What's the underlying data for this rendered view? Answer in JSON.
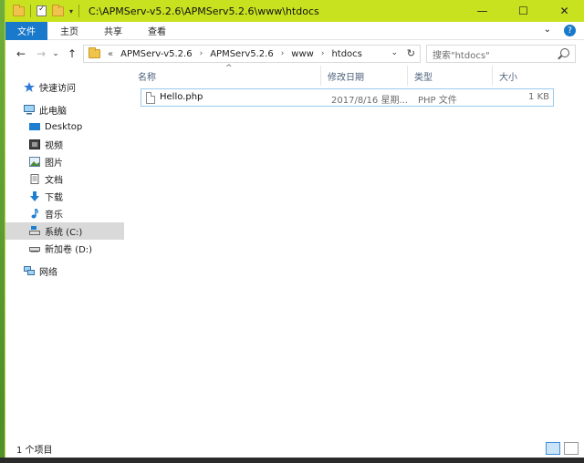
{
  "window": {
    "title": "C:\\APMServ-v5.2.6\\APMServ5.2.6\\www\\htdocs",
    "qat_dropdown": "▾",
    "controls": {
      "minimize": "—",
      "maximize": "☐",
      "close": "✕"
    }
  },
  "ribbon": {
    "tabs": [
      "文件",
      "主页",
      "共享",
      "查看"
    ],
    "collapse_glyph": "⌄",
    "help_glyph": "?"
  },
  "nav": {
    "back": "←",
    "forward": "→",
    "recent": "⌄",
    "up": "↑"
  },
  "address": {
    "overflow": "«",
    "crumbs": [
      "APMServ-v5.2.6",
      "APMServ5.2.6",
      "www",
      "htdocs"
    ],
    "separator": "›",
    "dropdown": "⌄",
    "refresh": "↻"
  },
  "search": {
    "placeholder": "搜索\"htdocs\""
  },
  "sidebar": {
    "items": [
      {
        "label": "快速访问",
        "icon": "star-icon"
      },
      {
        "label": "此电脑",
        "icon": "computer-icon"
      },
      {
        "label": "Desktop",
        "icon": "desktop-icon"
      },
      {
        "label": "视频",
        "icon": "video-icon"
      },
      {
        "label": "图片",
        "icon": "pictures-icon"
      },
      {
        "label": "文档",
        "icon": "documents-icon"
      },
      {
        "label": "下载",
        "icon": "download-icon"
      },
      {
        "label": "音乐",
        "icon": "music-icon"
      },
      {
        "label": "系统 (C:)",
        "icon": "drive-c-icon",
        "selected": true
      },
      {
        "label": "新加卷 (D:)",
        "icon": "drive-d-icon"
      },
      {
        "label": "网络",
        "icon": "network-icon"
      }
    ]
  },
  "columns": {
    "sort_glyph": "^",
    "headers": [
      "名称",
      "修改日期",
      "类型",
      "大小"
    ]
  },
  "files": [
    {
      "name": "Hello.php",
      "modified": "2017/8/16 星期...",
      "type": "PHP 文件",
      "size": "1 KB"
    }
  ],
  "status": {
    "item_count": "1 个项目"
  },
  "colors": {
    "title_bar": "#c9e21f",
    "file_tab": "#1979ca",
    "selection_border": "#99c9ef",
    "sidebar_selected": "#d9d9d9"
  }
}
